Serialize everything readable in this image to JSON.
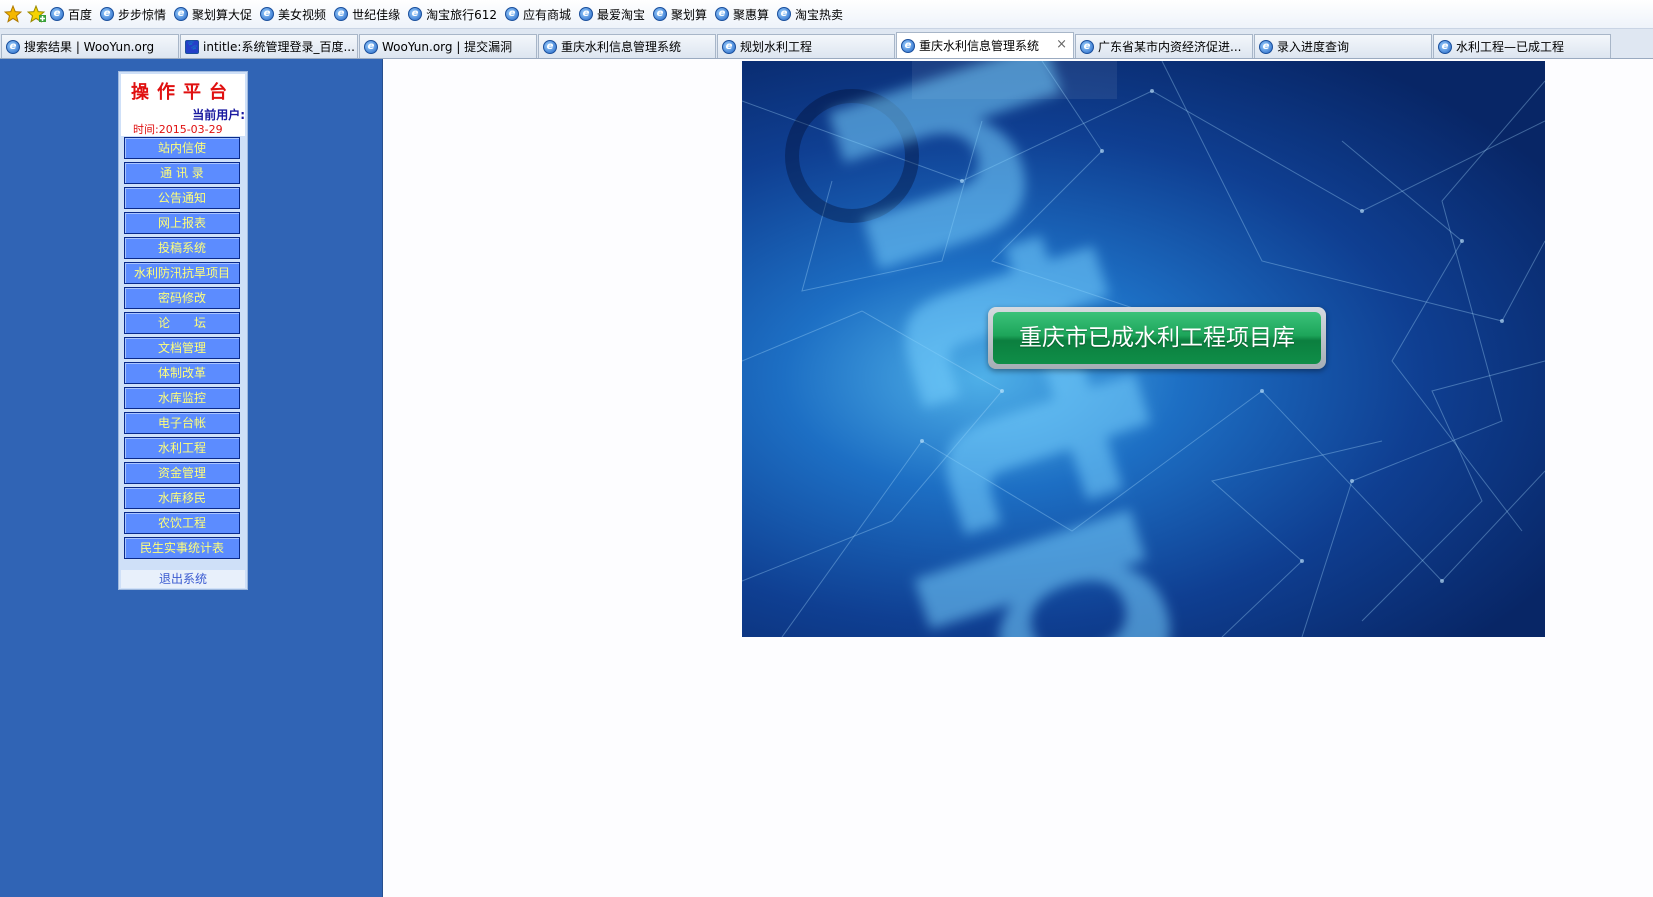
{
  "favorites": [
    {
      "label": "百度",
      "icon": "ie-icon"
    },
    {
      "label": "步步惊情",
      "icon": "ie-icon"
    },
    {
      "label": "聚划算大促",
      "icon": "ie-icon"
    },
    {
      "label": "美女视频",
      "icon": "ie-icon"
    },
    {
      "label": "世纪佳缘",
      "icon": "ie-icon"
    },
    {
      "label": "淘宝旅行612",
      "icon": "ie-icon"
    },
    {
      "label": "应有商城",
      "icon": "ie-icon"
    },
    {
      "label": "最爱淘宝",
      "icon": "ie-icon"
    },
    {
      "label": "聚划算",
      "icon": "ie-icon"
    },
    {
      "label": "聚惠算",
      "icon": "ie-icon"
    },
    {
      "label": "淘宝热卖",
      "icon": "ie-icon"
    }
  ],
  "tabs": [
    {
      "label": "搜索结果 | WooYun.org",
      "active": false
    },
    {
      "label": "intitle:系统管理登录_百度...",
      "active": false
    },
    {
      "label": "WooYun.org | 提交漏洞",
      "active": false
    },
    {
      "label": "重庆水利信息管理系统",
      "active": false
    },
    {
      "label": "规划水利工程",
      "active": false
    },
    {
      "label": "重庆水利信息管理系统",
      "active": true,
      "close": "×"
    },
    {
      "label": "广东省某市内资经济促进...",
      "active": false
    },
    {
      "label": "录入进度查询",
      "active": false
    },
    {
      "label": "水利工程—已成工程",
      "active": false
    }
  ],
  "panel": {
    "title": "操作平台",
    "user_label": "当前用户:",
    "time_label": "时间:",
    "time_value": "2015-03-29",
    "menu": [
      "站内信使",
      "通 讯 录",
      "公告通知",
      "网上报表",
      "投稿系统",
      "水利防汛抗旱项目",
      "密码修改",
      "论　　坛",
      "文档管理",
      "体制改革",
      "水库监控",
      "电子台帐",
      "水利工程",
      "资金管理",
      "水库移民",
      "农饮工程",
      "民生实事统计表"
    ],
    "logout": "退出系统"
  },
  "banner": {
    "button_label": "重庆市已成水利工程项目库",
    "background_text": "http:"
  },
  "colors": {
    "sidebar_bg": "#3064b5",
    "menu_btn": "#5c8cff",
    "menu_text": "#ffff7a",
    "title_red": "#e01010",
    "green_button": "#1da55a"
  }
}
